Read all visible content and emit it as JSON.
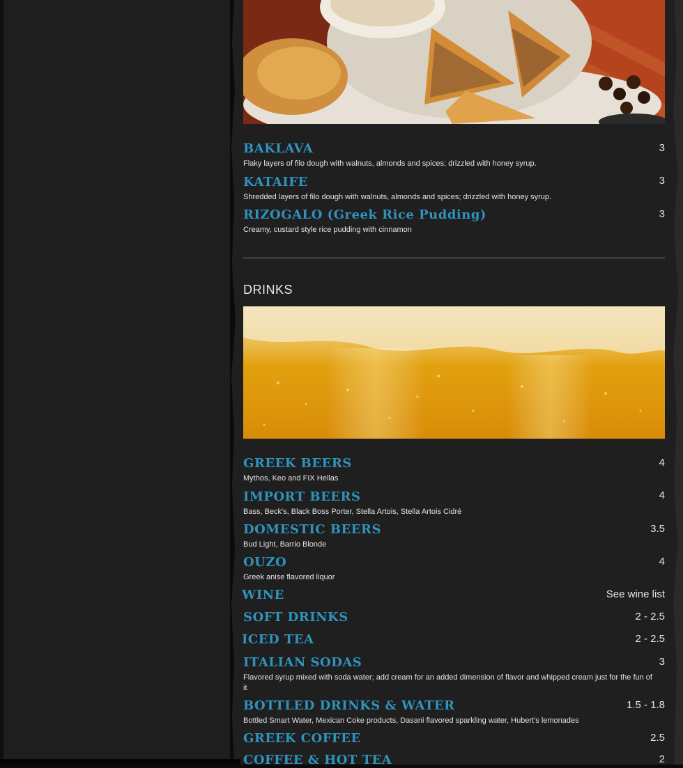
{
  "desserts": [
    {
      "name": "BAKLAVA",
      "price": "3",
      "desc": "Flaky layers of filo dough with walnuts, almonds and spices; drizzled with honey syrup."
    },
    {
      "name": "KATAIFE",
      "price": "3",
      "desc": "Shredded layers of filo dough with walnuts, almonds and spices; drizzled with honey syrup."
    },
    {
      "name": "RIZOGALO (Greek Rice Pudding)",
      "price": "3",
      "desc": "Creamy, custard style rice pudding with cinnamon"
    }
  ],
  "drinks_section_title": "DRINKS",
  "drinks": [
    {
      "name": "GREEK BEERS",
      "price": "4",
      "desc": "Mythos, Keo and FIX Hellas"
    },
    {
      "name": "IMPORT BEERS",
      "price": "4",
      "desc": "Bass, Beck's, Black Boss Porter, Stella Artois, Stella Artois Cidré"
    },
    {
      "name": "DOMESTIC BEERS",
      "price": "3.5",
      "desc": "Bud Light, Barrio Blonde"
    },
    {
      "name": "OUZO",
      "price": "4",
      "desc": "Greek anise flavored liquor"
    },
    {
      "name": "WINE",
      "price": "See wine list",
      "desc": ""
    },
    {
      "name": "SOFT DRINKS",
      "price": "2 - 2.5",
      "desc": ""
    },
    {
      "name": "ICED TEA",
      "price": "2 - 2.5",
      "desc": ""
    },
    {
      "name": "ITALIAN SODAS",
      "price": "3",
      "desc": "Flavored syrup mixed with soda water; add cream for an added dimension of flavor and whipped cream just for the fun of it"
    },
    {
      "name": "BOTTLED DRINKS & WATER",
      "price": "1.5 - 1.8",
      "desc": "Bottled Smart Water, Mexican Coke products, Dasani flavored sparkling water, Hubert's lemonades"
    },
    {
      "name": "GREEK COFFEE",
      "price": "2.5",
      "desc": ""
    },
    {
      "name": "COFFEE & HOT TEA",
      "price": "2",
      "desc": ""
    }
  ]
}
